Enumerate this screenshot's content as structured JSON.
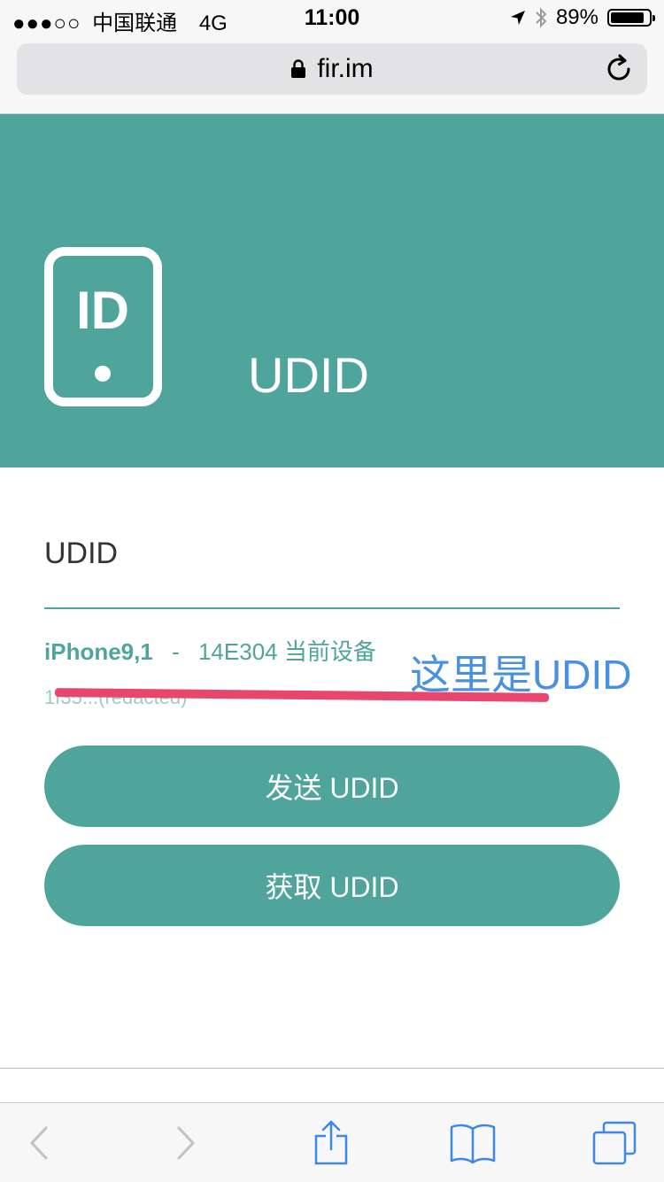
{
  "status_bar": {
    "signal": "●●●○○",
    "carrier": "中国联通",
    "network": "4G",
    "time": "11:00",
    "battery_percent": "89%",
    "battery_level": 0.89
  },
  "address_bar": {
    "url": "fir.im"
  },
  "hero": {
    "icon_text": "ID",
    "title": "UDID"
  },
  "content": {
    "section_title": "UDID",
    "device_model": "iPhone9,1",
    "separator": "-",
    "device_build": "14E304 当前设备",
    "udid_value": "1f35...(redacted)",
    "annotation": "这里是UDID"
  },
  "buttons": {
    "send": "发送 UDID",
    "get": "获取 UDID"
  },
  "toolbar": {
    "items": [
      "back-icon",
      "forward-icon",
      "share-icon",
      "bookmarks-icon",
      "tabs-icon"
    ]
  },
  "colors": {
    "accent": "#4fa59b",
    "annotation": "#4a90e2",
    "redaction": "#e8466d"
  }
}
